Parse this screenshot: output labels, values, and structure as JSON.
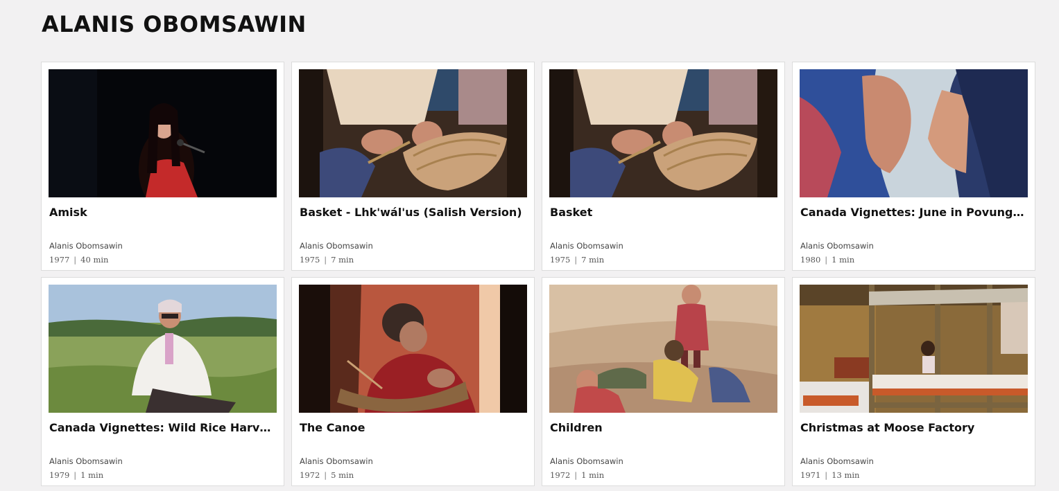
{
  "page": {
    "title": "ALANIS OBOMSAWIN"
  },
  "films": [
    {
      "title": "Amisk",
      "director": "Alanis Obomsawin",
      "year": "1977",
      "duration": "40 min"
    },
    {
      "title": "Basket - Lhk'wál'us (Salish Version)",
      "director": "Alanis Obomsawin",
      "year": "1975",
      "duration": "7 min"
    },
    {
      "title": "Basket",
      "director": "Alanis Obomsawin",
      "year": "1975",
      "duration": "7 min"
    },
    {
      "title": "Canada Vignettes: June in Povungnituk - ...",
      "director": "Alanis Obomsawin",
      "year": "1980",
      "duration": "1 min"
    },
    {
      "title": "Canada Vignettes: Wild Rice Harvest Ken...",
      "director": "Alanis Obomsawin",
      "year": "1979",
      "duration": "1 min"
    },
    {
      "title": "The Canoe",
      "director": "Alanis Obomsawin",
      "year": "1972",
      "duration": "5 min"
    },
    {
      "title": "Children",
      "director": "Alanis Obomsawin",
      "year": "1972",
      "duration": "1 min"
    },
    {
      "title": "Christmas at Moose Factory",
      "director": "Alanis Obomsawin",
      "year": "1971",
      "duration": "13 min"
    }
  ],
  "meta_separator": "|"
}
